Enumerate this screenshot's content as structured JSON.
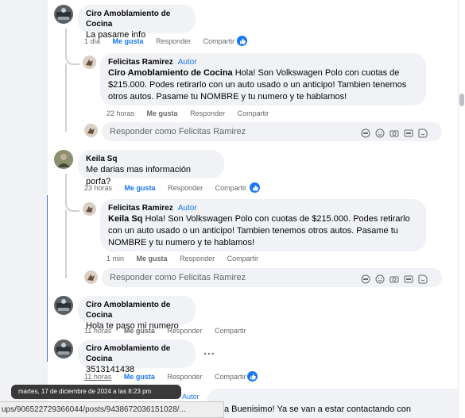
{
  "comments": [
    {
      "author": "Ciro Amoblamiento de Cocina",
      "text": "La pasame info",
      "actions": {
        "time": "1 día",
        "like": "Me gusta",
        "reply": "Responder",
        "share": "Compartir"
      }
    },
    {
      "author": "Felicitas Ramirez",
      "badge": "Autor",
      "mention": "Ciro Amoblamiento de Cocina",
      "text_lines": [
        " Hola! Son Volkswagen Polo con cuotas de",
        "$215.000. Podes retirarlo con un auto usado o un anticipo! Tambien tenemos",
        "otros autos. Pasame tu NOMBRE y tu numero y te hablamos!"
      ],
      "actions": {
        "time": "22 horas",
        "like": "Me gusta",
        "reply": "Responder",
        "share": "Compartir"
      }
    },
    {
      "author": "Keila Sq",
      "text": "Me darias mas información porfa?",
      "actions": {
        "time": "23 horas",
        "like": "Me gusta",
        "reply": "Responder",
        "share": "Compartir"
      }
    },
    {
      "author": "Felicitas Ramirez",
      "badge": "Autor",
      "mention": "Keila Sq",
      "text_lines": [
        " Hola! Son Volkswagen Polo con cuotas de $215.000. Podes retirarlo",
        "con un auto usado o un anticipo! Tambien tenemos otros autos. Pasame tu",
        "NOMBRE y tu numero y te hablamos!"
      ],
      "actions": {
        "time": "1 min",
        "like": "Me gusta",
        "reply": "Responder",
        "share": "Compartir"
      }
    },
    {
      "author": "Ciro Amoblamiento de Cocina",
      "text": "Hola te paso mi numero",
      "actions": {
        "time": "11 horas",
        "like": "Me gusta",
        "reply": "Responder",
        "share": "Compartir"
      }
    },
    {
      "author": "Ciro Amoblamiento de Cocina",
      "text": "3513141438",
      "more": "...",
      "actions": {
        "time": "11 horas",
        "like": "Me gusta",
        "reply": "Responder",
        "share": "Compartir"
      }
    }
  ],
  "reply_placeholder": "Responder como Felicitas Ramirez",
  "tooltip": "martes, 17 de diciembre de 2024 a las 8:23 pm",
  "status_url": "ups/906522729366044/posts/9438672036151028/...",
  "bottom_partial_badge": "Autor",
  "bottom_text": "a Buenisimo! Ya se van a estar contactando con",
  "colors": {
    "accent": "#1877f2",
    "bubble": "#f0f2f5",
    "muted": "#65676b"
  },
  "icons": [
    "like-icon",
    "gif-icon",
    "emoji-icon",
    "camera-icon",
    "gif-box-icon",
    "sticker-icon"
  ]
}
